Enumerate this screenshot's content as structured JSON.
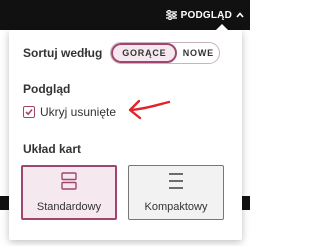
{
  "header": {
    "preview_button_label": "PODGLĄD",
    "preview_icon": "sliders-icon",
    "expand_icon": "caret-up-icon"
  },
  "panel": {
    "sort": {
      "label": "Sortuj według",
      "options": [
        "GORĄCE",
        "NOWE"
      ],
      "selected": "GORĄCE"
    },
    "preview_section": {
      "title": "Podgląd",
      "checkbox_label": "Ukryj usunięte",
      "checked": true
    },
    "layout_section": {
      "title": "Układ kart",
      "cards": [
        {
          "label": "Standardowy",
          "icon": "standard-layout-icon",
          "selected": true
        },
        {
          "label": "Kompaktowy",
          "icon": "compact-layout-icon",
          "selected": false
        }
      ]
    }
  },
  "colors": {
    "accent": "#a0466e",
    "accent_bg": "#f5e9ef",
    "annotation_arrow": "#e0242a",
    "topbar": "#111111"
  }
}
